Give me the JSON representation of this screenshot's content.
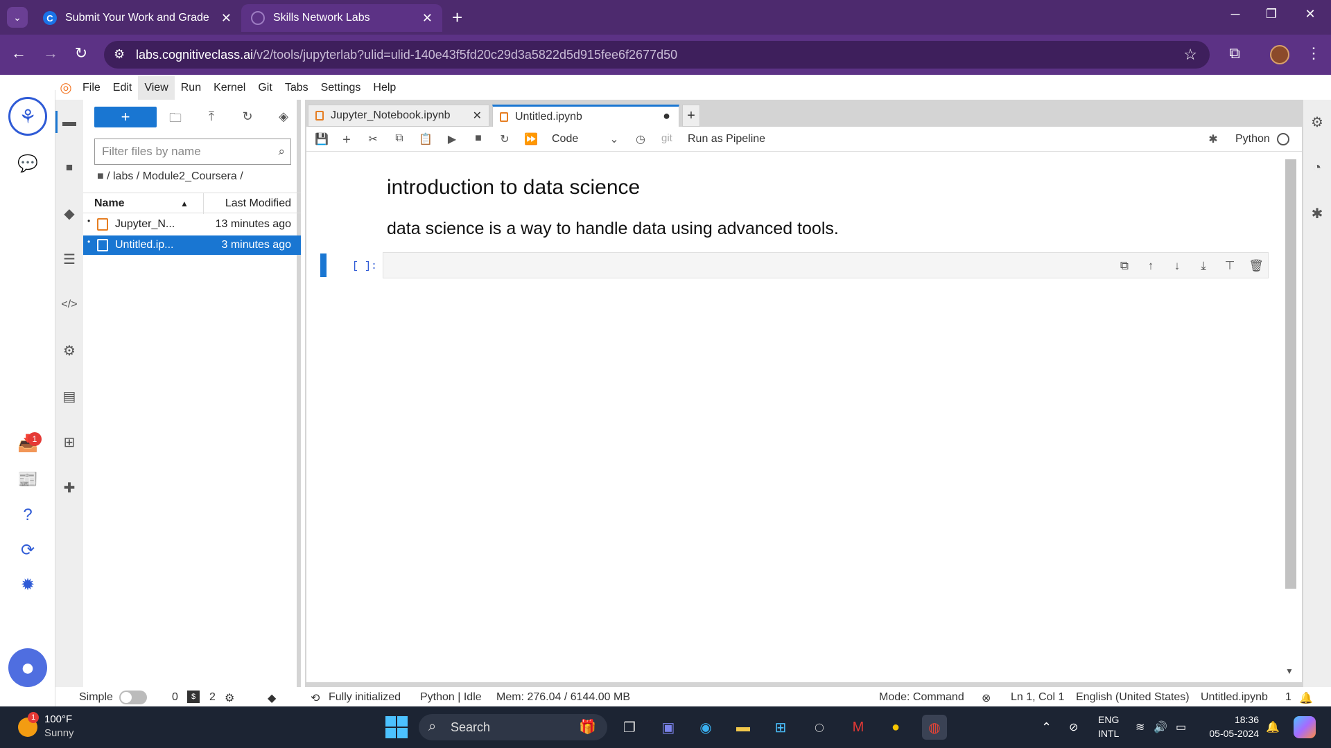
{
  "browser": {
    "tabs": [
      {
        "title": "Submit Your Work and Grade Yo",
        "favicon": "C"
      },
      {
        "title": "Skills Network Labs"
      }
    ],
    "url_host": "labs.cognitiveclass.ai",
    "url_path": "/v2/tools/jupyterlab?ulid=ulid-140e43f5fd20c29d3a5822d5d915fee6f2677d50"
  },
  "menu": [
    "File",
    "Edit",
    "View",
    "Run",
    "Kernel",
    "Git",
    "Tabs",
    "Settings",
    "Help"
  ],
  "filebrowser": {
    "filter_placeholder": "Filter files by name",
    "breadcrumb": "/ labs / Module2_Coursera /",
    "col_name": "Name",
    "col_modified": "Last Modified",
    "files": [
      {
        "name": "Jupyter_N...",
        "modified": "13 minutes ago"
      },
      {
        "name": "Untitled.ip...",
        "modified": "3 minutes ago"
      }
    ]
  },
  "notebook": {
    "tabs": [
      {
        "title": "Jupyter_Notebook.ipynb"
      },
      {
        "title": "Untitled.ipynb"
      }
    ],
    "cell_type": "Code",
    "git_label": "git",
    "pipeline_label": "Run as Pipeline",
    "kernel": "Python",
    "heading": "introduction to data science",
    "paragraph": "data science is a way to handle data using advanced tools.",
    "prompt": "[ ]:"
  },
  "statusbar": {
    "mode_label": "Simple",
    "terminals": "0",
    "kernels": "2",
    "init": "Fully initialized",
    "kernel_status": "Python | Idle",
    "mem": "Mem: 276.04 / 6144.00 MB",
    "mode": "Mode: Command",
    "cursor": "Ln 1, Col 1",
    "lang": "English (United States)",
    "file": "Untitled.ipynb",
    "notifications": "1"
  },
  "taskbar": {
    "weather_temp": "100°F",
    "weather_desc": "Sunny",
    "weather_badge": "1",
    "search": "Search",
    "lang1": "ENG",
    "lang2": "INTL",
    "time": "18:36",
    "date": "05-05-2024"
  },
  "rail_badge": "1"
}
